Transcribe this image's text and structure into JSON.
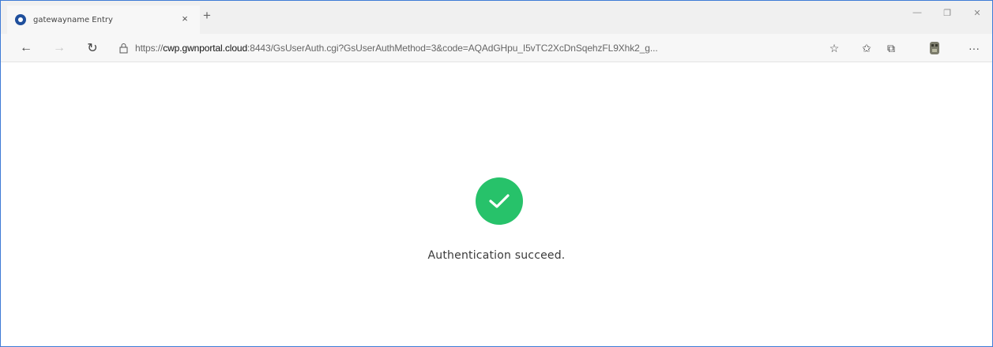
{
  "tab": {
    "title": "gatewayname Entry",
    "favicon": "edge-logo-icon",
    "close": "×"
  },
  "new_tab": "+",
  "window_controls": {
    "minimize": "—",
    "restore": "❐",
    "close": "✕"
  },
  "toolbar": {
    "back": "←",
    "forward": "→",
    "refresh": "↻",
    "url_scheme": "https://",
    "url_host": "cwp.gwnportal.cloud",
    "url_rest": ":8443/GsUserAuth.cgi?GsUserAuthMethod=3&code=AQAdGHpu_I5vTC2XcDnSqehzFL9Xhk2_g...",
    "favorite": "☆",
    "favorites_hub": "✩",
    "collections": "⧉",
    "more": "···"
  },
  "page": {
    "message": "Authentication succeed.",
    "success_color": "#27c26a"
  }
}
